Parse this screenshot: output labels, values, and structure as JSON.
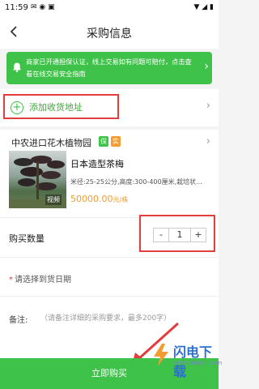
{
  "status_bar": {
    "time": "11:59"
  },
  "header": {
    "title": "采购信息"
  },
  "notice": {
    "text": "商家已开通担保认证，线上交易如有问题可赔付，点击查看在线交易安全指南"
  },
  "address": {
    "label": "添加收货地址"
  },
  "shop": {
    "name": "中农进口花木植物园",
    "badge_guarantee": "保",
    "badge_real": "实"
  },
  "product": {
    "title": "日本造型茶梅",
    "spec": "米径:25-25公分,高度:300-400厘米,栽培状...",
    "price": "50000.00",
    "price_unit": "元/株",
    "video_tag": "视频"
  },
  "quantity": {
    "label": "购买数量",
    "value": "1",
    "minus": "-",
    "plus": "+"
  },
  "delivery_date": {
    "required_mark": "*",
    "label": "请选择到货日期"
  },
  "note": {
    "label": "备注:",
    "placeholder": "（请备注详细的采购要求，最多200字）"
  },
  "buy_button": {
    "label": "立即购买"
  },
  "watermark": {
    "text": "闪电下载",
    "url": "www.dianlut.com"
  },
  "colors": {
    "accent": "#3fc24a",
    "price": "#f39c32",
    "highlight": "#e23c3c"
  }
}
